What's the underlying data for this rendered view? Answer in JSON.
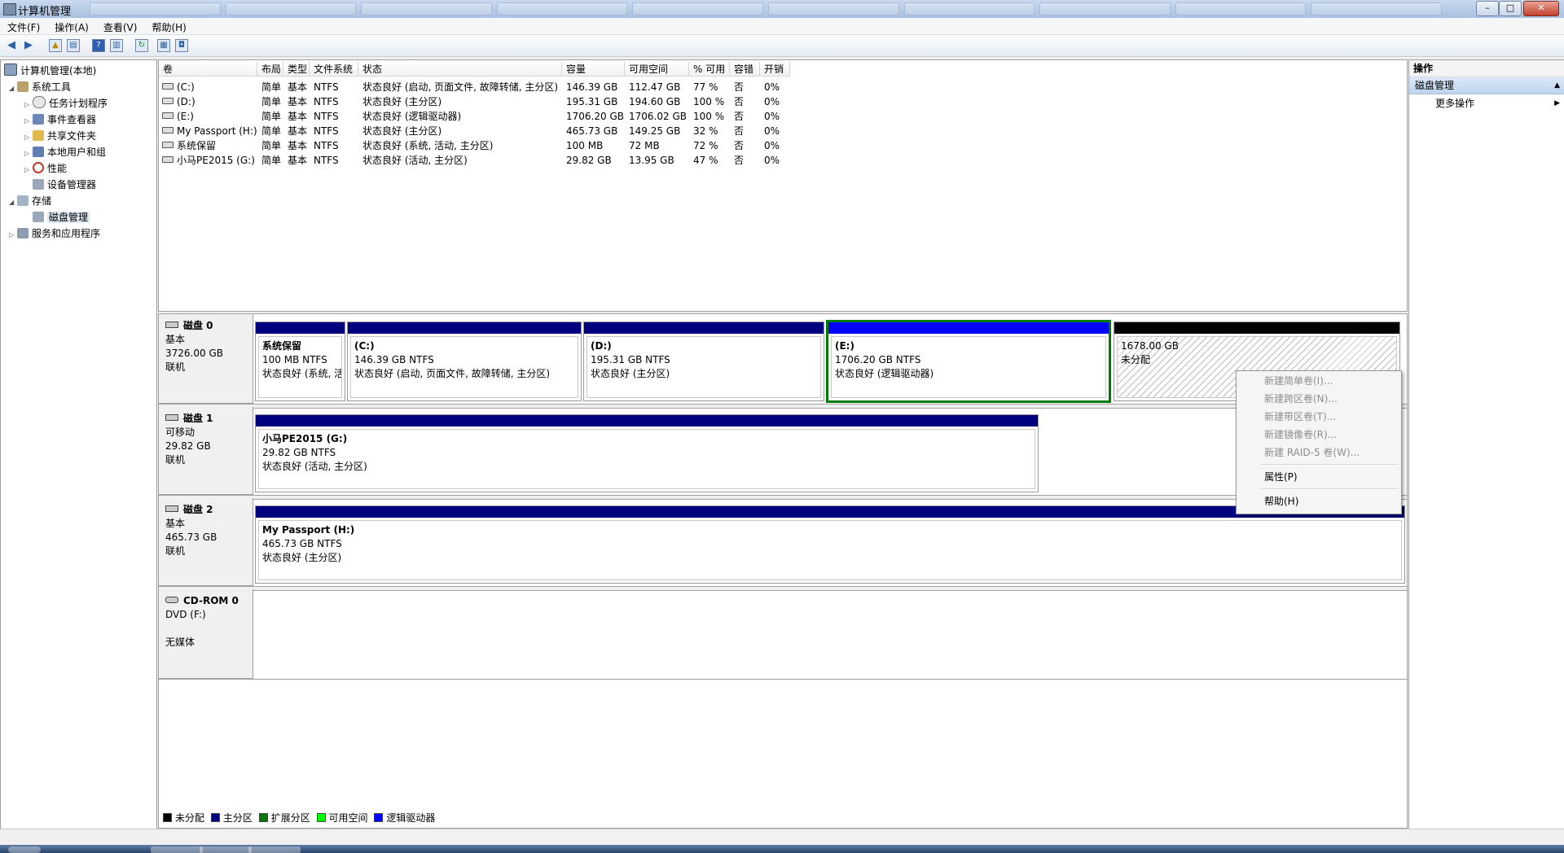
{
  "window": {
    "title": "计算机管理"
  },
  "menu": [
    "文件(F)",
    "操作(A)",
    "查看(V)",
    "帮助(H)"
  ],
  "tree": [
    {
      "label": "计算机管理(本地)",
      "icon": "computer-icon",
      "level": 0,
      "expanded": true
    },
    {
      "label": "系统工具",
      "icon": "tools-icon",
      "level": 1,
      "expanded": true
    },
    {
      "label": "任务计划程序",
      "icon": "clock-icon",
      "level": 2
    },
    {
      "label": "事件查看器",
      "icon": "event-viewer-icon",
      "level": 2
    },
    {
      "label": "共享文件夹",
      "icon": "shared-folder-icon",
      "level": 2
    },
    {
      "label": "本地用户和组",
      "icon": "users-icon",
      "level": 2
    },
    {
      "label": "性能",
      "icon": "performance-icon",
      "level": 2
    },
    {
      "label": "设备管理器",
      "icon": "device-manager-icon",
      "level": 2
    },
    {
      "label": "存储",
      "icon": "storage-icon",
      "level": 1,
      "expanded": true
    },
    {
      "label": "磁盘管理",
      "icon": "disk-management-icon",
      "level": 2,
      "selected": true
    },
    {
      "label": "服务和应用程序",
      "icon": "services-icon",
      "level": 1
    }
  ],
  "volume_table": {
    "columns": [
      "卷",
      "布局",
      "类型",
      "文件系统",
      "状态",
      "容量",
      "可用空间",
      "% 可用",
      "容错",
      "开销"
    ],
    "rows": [
      [
        "(C:)",
        "简单",
        "基本",
        "NTFS",
        "状态良好 (启动, 页面文件, 故障转储, 主分区)",
        "146.39 GB",
        "112.47 GB",
        "77 %",
        "否",
        "0%"
      ],
      [
        "(D:)",
        "简单",
        "基本",
        "NTFS",
        "状态良好 (主分区)",
        "195.31 GB",
        "194.60 GB",
        "100 %",
        "否",
        "0%"
      ],
      [
        "(E:)",
        "简单",
        "基本",
        "NTFS",
        "状态良好 (逻辑驱动器)",
        "1706.20 GB",
        "1706.02 GB",
        "100 %",
        "否",
        "0%"
      ],
      [
        "My Passport (H:)",
        "简单",
        "基本",
        "NTFS",
        "状态良好 (主分区)",
        "465.73 GB",
        "149.25 GB",
        "32 %",
        "否",
        "0%"
      ],
      [
        "系统保留",
        "简单",
        "基本",
        "NTFS",
        "状态良好 (系统, 活动, 主分区)",
        "100 MB",
        "72 MB",
        "72 %",
        "否",
        "0%"
      ],
      [
        "小马PE2015 (G:)",
        "简单",
        "基本",
        "NTFS",
        "状态良好 (活动, 主分区)",
        "29.82 GB",
        "13.95 GB",
        "47 %",
        "否",
        "0%"
      ]
    ]
  },
  "disks": [
    {
      "name": "磁盘 0",
      "type": "基本",
      "size": "3726.00 GB",
      "status": "联机",
      "partitions": [
        {
          "title": "系统保留",
          "size": "100 MB NTFS",
          "status": "状态良好 (系统, 活"
        },
        {
          "title": "(C:)",
          "size": "146.39 GB NTFS",
          "status": "状态良好 (启动, 页面文件, 故障转储, 主分区)"
        },
        {
          "title": "(D:)",
          "size": "195.31 GB NTFS",
          "status": "状态良好 (主分区)"
        },
        {
          "title": "(E:)",
          "size": "1706.20 GB NTFS",
          "status": "状态良好 (逻辑驱动器)"
        },
        {
          "title": "",
          "size": "1678.00 GB",
          "status": "未分配"
        }
      ]
    },
    {
      "name": "磁盘 1",
      "type": "可移动",
      "size": "29.82 GB",
      "status": "联机",
      "partitions": [
        {
          "title": "小马PE2015  (G:)",
          "size": "29.82 GB NTFS",
          "status": "状态良好 (活动, 主分区)"
        }
      ]
    },
    {
      "name": "磁盘 2",
      "type": "基本",
      "size": "465.73 GB",
      "status": "联机",
      "partitions": [
        {
          "title": "My Passport  (H:)",
          "size": "465.73 GB NTFS",
          "status": "状态良好 (主分区)"
        }
      ]
    },
    {
      "name": "CD-ROM 0",
      "type": "DVD (F:)",
      "size": "",
      "status": "无媒体"
    }
  ],
  "legend": [
    {
      "label": "未分配",
      "color": "#000000"
    },
    {
      "label": "主分区",
      "color": "#00007f"
    },
    {
      "label": "扩展分区",
      "color": "#007a00"
    },
    {
      "label": "可用空间",
      "color": "#00ff00"
    },
    {
      "label": "逻辑驱动器",
      "color": "#0000ff"
    }
  ],
  "actions": {
    "header": "操作",
    "section": "磁盘管理",
    "more": "更多操作"
  },
  "context_menu": {
    "new_simple": "新建简单卷(I)...",
    "new_spanned": "新建跨区卷(N)...",
    "new_striped": "新建带区卷(T)...",
    "new_mirrored": "新建镜像卷(R)...",
    "new_raid5": "新建 RAID-5 卷(W)...",
    "properties": "属性(P)",
    "help": "帮助(H)"
  },
  "colors": {
    "primary": "#00007f",
    "logical": "#0000ff",
    "unallocated": "#000000",
    "selection": "#007a00"
  }
}
